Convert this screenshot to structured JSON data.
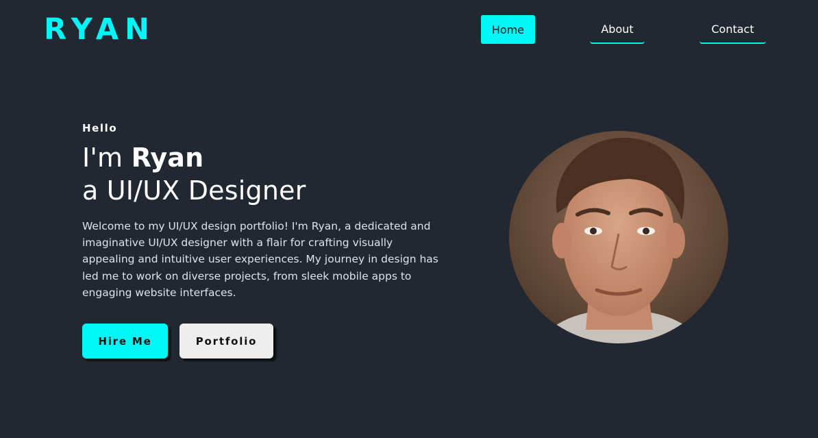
{
  "header": {
    "logo": "RYAN",
    "nav": [
      {
        "label": "Home",
        "active": true
      },
      {
        "label": "About",
        "active": false
      },
      {
        "label": "Contact",
        "active": false
      }
    ]
  },
  "hero": {
    "greeting": "Hello",
    "headline_prefix": "I'm ",
    "headline_name": "Ryan",
    "headline_role": "a UI/UX Designer",
    "intro": "Welcome to my UI/UX design portfolio! I'm Ryan, a dedicated and imaginative UI/UX designer with a flair for crafting visually appealing and intuitive user experiences. My journey in design has led me to work on diverse projects, from sleek mobile apps to engaging website interfaces.",
    "buttons": {
      "hire_label": "Hire Me",
      "portfolio_label": "Portfolio"
    },
    "portrait_icon": "profile-photo"
  },
  "colors": {
    "background": "#222831",
    "accent": "#00f7f7",
    "secondary_button": "#eeeeee",
    "text": "#ffffff"
  }
}
